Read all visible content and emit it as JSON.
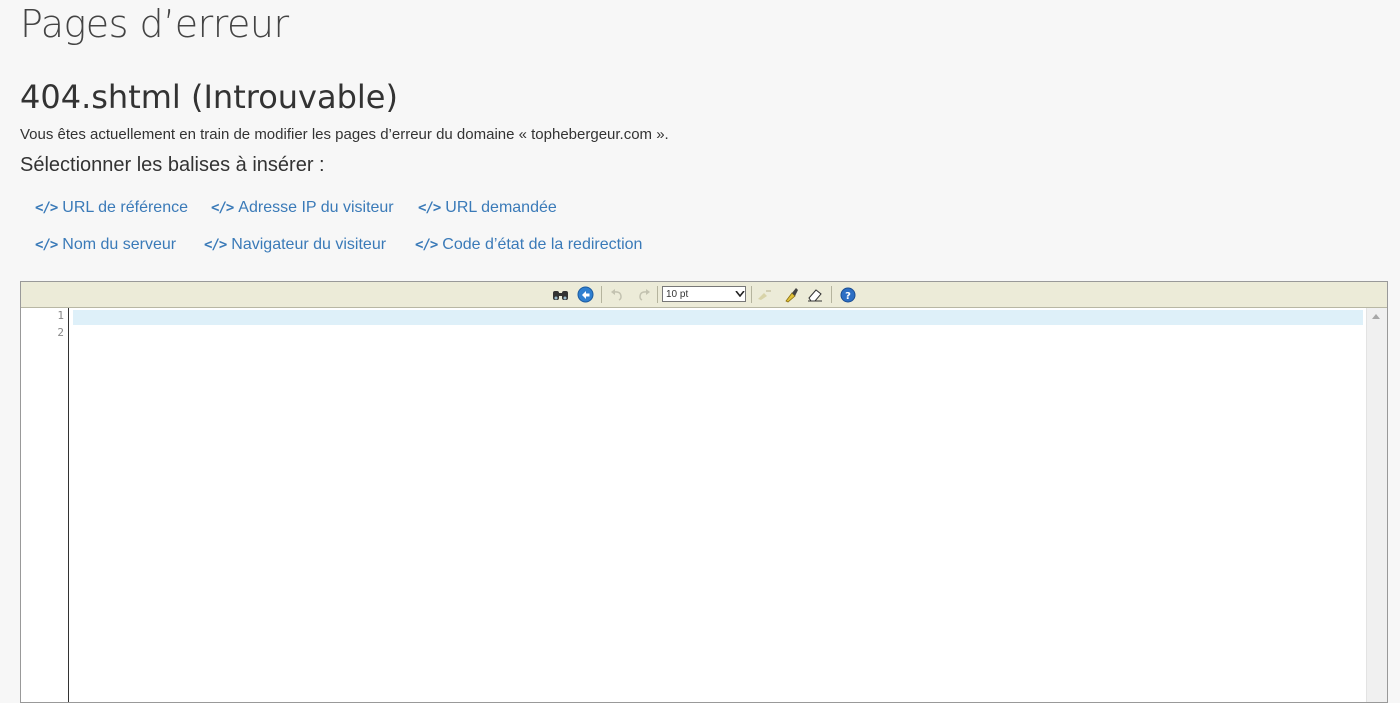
{
  "header": {
    "title": "Pages d’erreur",
    "file_title": "404.shtml (Introuvable)",
    "description": "Vous êtes actuellement en train de modifier les pages d’erreur du domaine « tophebergeur.com ».",
    "select_label": "Sélectionner les balises à insérer :"
  },
  "tags": {
    "icon": "</>",
    "items": [
      {
        "label": "URL de référence"
      },
      {
        "label": "Adresse IP du visiteur"
      },
      {
        "label": "URL demandée"
      },
      {
        "label": "Nom du serveur"
      },
      {
        "label": "Navigateur du visiteur"
      },
      {
        "label": "Code d’état de la redirection"
      }
    ]
  },
  "editor": {
    "font_size": "10 pt",
    "line_numbers": [
      "1",
      "2"
    ],
    "content": ""
  },
  "colors": {
    "link": "#3a7ab8",
    "toolbar_bg": "#ecebd8",
    "active_line": "#def0f9"
  }
}
